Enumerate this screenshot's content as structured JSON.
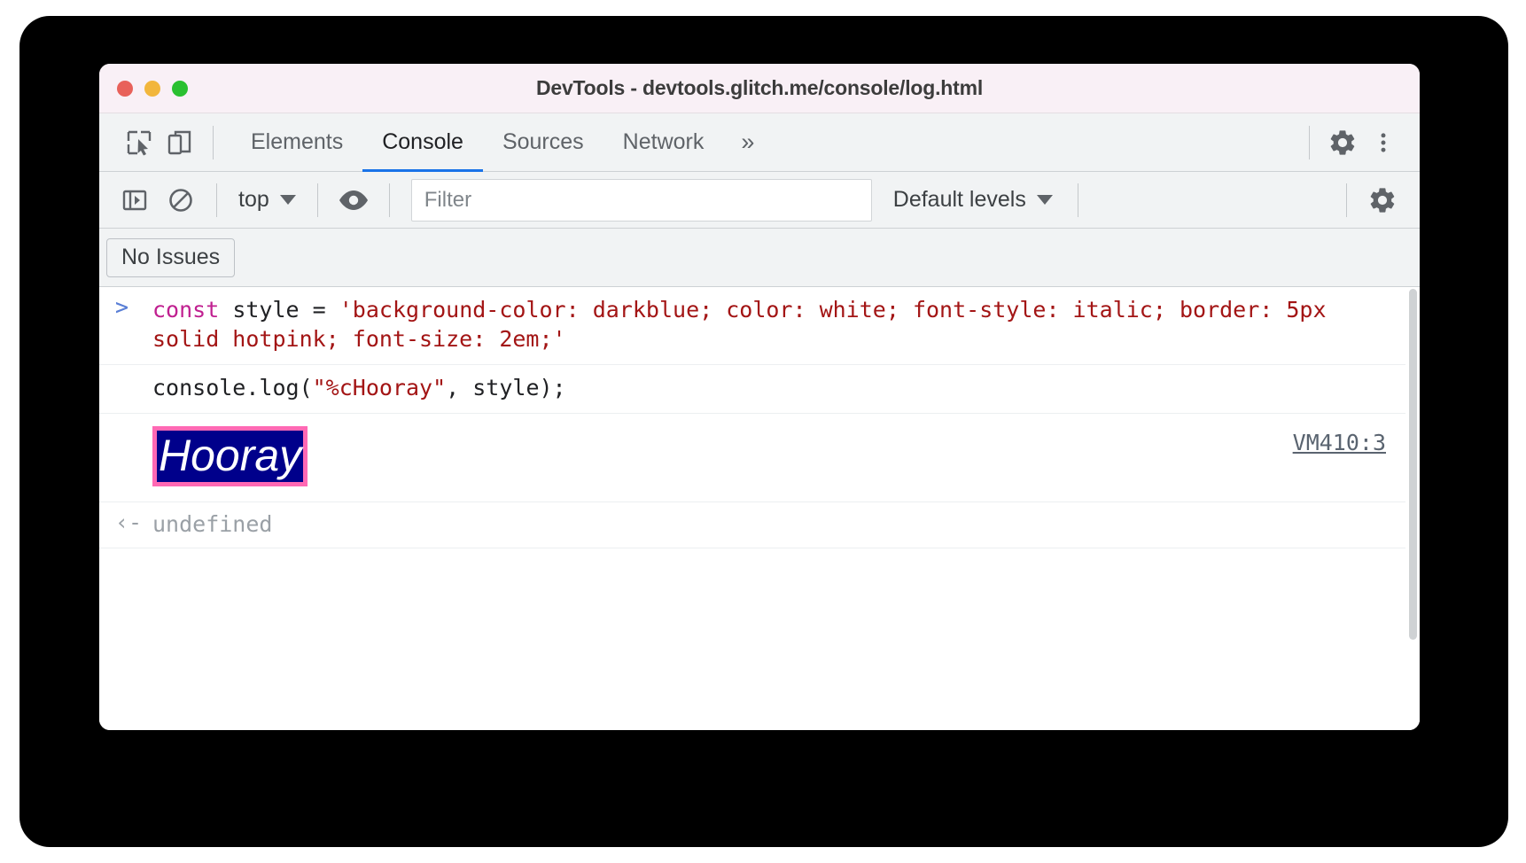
{
  "window": {
    "title": "DevTools - devtools.glitch.me/console/log.html",
    "traffic_lights": [
      {
        "name": "close",
        "color": "#e8615a"
      },
      {
        "name": "minimize",
        "color": "#f2b63c"
      },
      {
        "name": "maximize",
        "color": "#2ac030"
      }
    ]
  },
  "tabbar": {
    "inspect_icon": "inspect-element-icon",
    "device_icon": "device-toolbar-icon",
    "tabs": [
      {
        "label": "Elements",
        "active": false
      },
      {
        "label": "Console",
        "active": true
      },
      {
        "label": "Sources",
        "active": false
      },
      {
        "label": "Network",
        "active": false
      }
    ],
    "more_tabs": "»",
    "settings_icon": "gear-icon",
    "menu_icon": "kebab-menu-icon",
    "active_underline_color": "#1a73e8"
  },
  "console_toolbar": {
    "sidebar_icon": "console-sidebar-icon",
    "clear_icon": "clear-console-icon",
    "context": "top",
    "context_caret": "▼",
    "eye_icon": "live-expression-icon",
    "filter_placeholder": "Filter",
    "filter_value": "",
    "levels": "Default levels",
    "levels_caret": "▼",
    "settings_icon": "console-settings-gear-icon"
  },
  "issues_bar": {
    "button_label": "No Issues"
  },
  "console": {
    "rows": [
      {
        "type": "input",
        "gutter": ">",
        "segments": [
          {
            "text": "const ",
            "class": "kw"
          },
          {
            "text": "style = ",
            "class": "plain"
          },
          {
            "text": "'background-color: darkblue; color: white; font-style: italic; border: 5px solid hotpink; font-size: 2em;'",
            "class": "str"
          }
        ]
      },
      {
        "type": "input",
        "gutter": "",
        "segments": [
          {
            "text": "console.log(",
            "class": "plain"
          },
          {
            "text": "\"%cHooray\"",
            "class": "str"
          },
          {
            "text": ", style);",
            "class": "plain"
          }
        ]
      },
      {
        "type": "log",
        "text": "Hooray",
        "source": "VM410:3",
        "style": {
          "background_color": "#00008b",
          "color": "#ffffff",
          "font_style": "italic",
          "border": "5px solid hotpink",
          "border_color": "#ff69b4",
          "font_size": "2em"
        }
      },
      {
        "type": "result",
        "gutter": "‹-",
        "text": "undefined"
      },
      {
        "type": "prompt",
        "gutter": ">",
        "text": ""
      }
    ]
  }
}
